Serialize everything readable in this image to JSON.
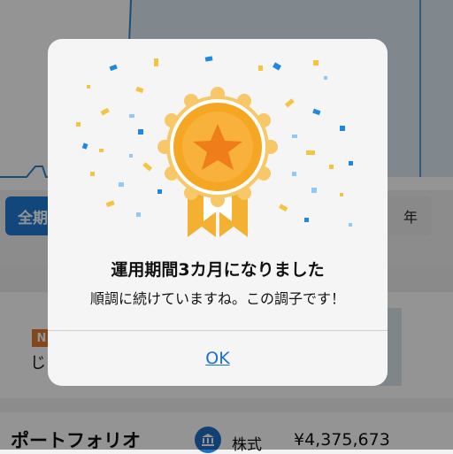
{
  "background": {
    "period_active_label": "全期",
    "period_other_label": "年",
    "card_badge": "N",
    "card_text": "じ",
    "portfolio_title": "ポートフォリオ",
    "stock_label": "株式",
    "stock_value": "¥4,375,673",
    "chart_line_color": "#2f87c9",
    "accent_color": "#1f7bd6"
  },
  "dialog": {
    "title": "運用期間3カ月になりました",
    "message": "順調に続けていますね。この調子です！",
    "ok_label": "OK",
    "medal_icon": "award-medal-star-icon",
    "medal_color": "#f5a623",
    "ribbon_color": "#f4b030",
    "confetti_colors": [
      "#1e88e5",
      "#f6c443",
      "#90caf9"
    ],
    "link_color": "#1a6fd1"
  }
}
